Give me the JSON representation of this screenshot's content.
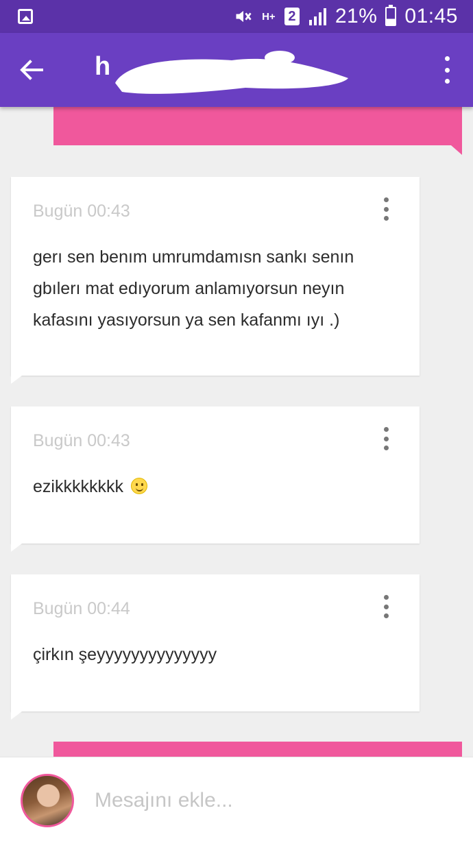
{
  "status_bar": {
    "battery_percent": "21%",
    "time": "01:45",
    "sim_slot": "2",
    "network_type": "H+",
    "icons": [
      "gallery-icon",
      "mute-icon",
      "network-icon",
      "sim-icon",
      "signal-icon",
      "battery-icon"
    ]
  },
  "header": {
    "title_visible": "h",
    "title_redacted": true,
    "back_icon": "arrow-left-icon",
    "menu_icon": "more-vert-icon"
  },
  "messages": [
    {
      "time": "Bugün 00:43",
      "text_lines": [
        "gerı sen benım umrumdamısn sankı senın",
        "gbılerı mat edıyorum anlamıyorsun neyın",
        "kafasını yasıyorsun ya sen kafanmı ıyı .)"
      ]
    },
    {
      "time": "Bugün 00:43",
      "text": "ezikkkkkkkk",
      "emoji": "slightly-smiling-face"
    },
    {
      "time": "Bugün 00:44",
      "text": "çirkın şeyyyyyyyyyyyyyy"
    }
  ],
  "composer": {
    "placeholder": "Mesajını ekle..."
  },
  "colors": {
    "status_bar": "#5b32a8",
    "app_bar": "#6a3fc2",
    "outgoing_bubble": "#f0589c",
    "timestamp": "#c9c9c9"
  }
}
